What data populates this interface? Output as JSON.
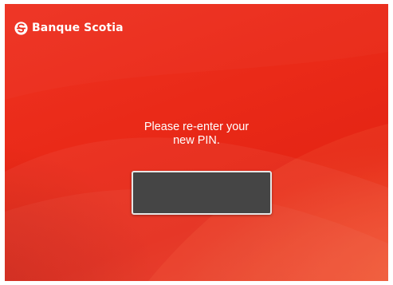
{
  "brand": {
    "name": "Banque Scotia",
    "logo_icon": "scotiabank-s-logo-icon",
    "brand_color": "#ec2a1a"
  },
  "prompt": {
    "line1": "Please re-enter your",
    "line2": "new PIN."
  },
  "pin_input": {
    "value": "",
    "field_color": "#454545"
  }
}
